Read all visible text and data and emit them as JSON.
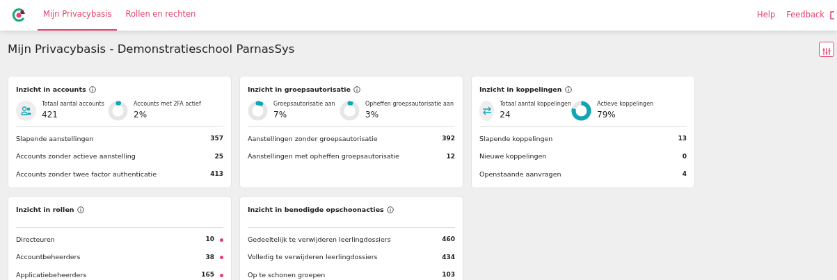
{
  "nav": {
    "tabs": [
      {
        "label": "Mijn Privacybasis",
        "selected": true
      },
      {
        "label": "Rollen en rechten",
        "selected": false
      }
    ],
    "links": [
      "Help",
      "Feedback"
    ]
  },
  "page_title": "Mijn Privacybasis - Demonstratieschool ParnasSys",
  "cards": [
    {
      "title": "Inzicht in accounts",
      "stats": [
        {
          "kind": "users",
          "label": "Totaal aantal accounts",
          "value": "421"
        },
        {
          "kind": "donut",
          "label": "Accounts met 2FA actief",
          "value": "2%",
          "level": 0.02
        }
      ],
      "rows": [
        {
          "label": "Slapende aanstellingen",
          "value": "357"
        },
        {
          "label": "Accounts zonder actieve aanstelling",
          "value": "25"
        },
        {
          "label": "Accounts zonder twee factor authenticatie",
          "value": "413"
        }
      ]
    },
    {
      "title": "Inzicht in groepsautorisatie",
      "stats": [
        {
          "kind": "donut",
          "label": "Groepsautorisatie aan",
          "value": "7%",
          "level": 0.07
        },
        {
          "kind": "donut",
          "label": "Opheffen groepsautorisatie aan",
          "value": "3%",
          "level": 0.03
        }
      ],
      "rows": [
        {
          "label": "Aanstellingen zonder groepsautorisatie",
          "value": "392"
        },
        {
          "label": "Aanstellingen met opheffen groepsautorisatie",
          "value": "12"
        }
      ]
    },
    {
      "title": "Inzicht in koppelingen",
      "stats": [
        {
          "kind": "links",
          "label": "Totaal aantal koppelingen",
          "value": "24"
        },
        {
          "kind": "donut",
          "label": "Actieve koppelingen",
          "value": "79%",
          "level": 0.79
        }
      ],
      "rows": [
        {
          "label": "Slapende koppelingen",
          "value": "13"
        },
        {
          "label": "Nieuwe koppelingen",
          "value": "0"
        },
        {
          "label": "Openstaande aanvragen",
          "value": "4"
        }
      ]
    },
    {
      "title": "Inzicht in rollen",
      "rows": [
        {
          "label": "Directeuren",
          "value": "10",
          "color": "#e5426b"
        },
        {
          "label": "Accountbeheerders",
          "value": "38",
          "color": "#e5426b"
        },
        {
          "label": "Applicatiebeheerders",
          "value": "165",
          "color": "#e5426b"
        }
      ]
    },
    {
      "title": "Inzicht in benodigde opschoonacties",
      "rows": [
        {
          "label": "Gedeeltelijk te verwijderen leerlingdossiers",
          "value": "460"
        },
        {
          "label": "Volledig te verwijderen leerlingdossiers",
          "value": "434"
        },
        {
          "label": "Op te schonen groepen",
          "value": "103"
        }
      ]
    }
  ]
}
